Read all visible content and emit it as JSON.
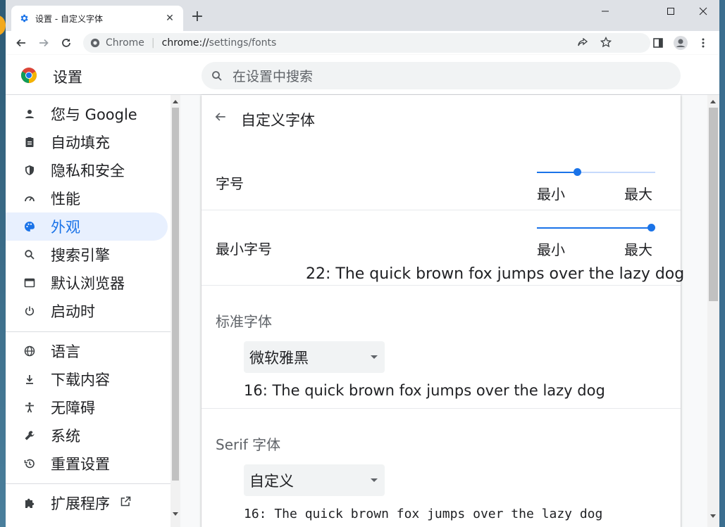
{
  "tab": {
    "title": "设置 - 自定义字体",
    "close": "✕",
    "new_tab": "+"
  },
  "window_controls": {
    "minimize": "—",
    "maximize": "☐",
    "close": "✕"
  },
  "omnibox": {
    "site": "Chrome",
    "url_host": "chrome://",
    "url_rest": "settings/fonts"
  },
  "header": {
    "title": "设置",
    "search_placeholder": "在设置中搜索"
  },
  "sidebar": {
    "items": [
      {
        "label": "您与 Google",
        "icon": "person-icon"
      },
      {
        "label": "自动填充",
        "icon": "clipboard-icon"
      },
      {
        "label": "隐私和安全",
        "icon": "shield-icon"
      },
      {
        "label": "性能",
        "icon": "speedometer-icon"
      },
      {
        "label": "外观",
        "icon": "palette-icon",
        "active": true
      },
      {
        "label": "搜索引擎",
        "icon": "search-icon"
      },
      {
        "label": "默认浏览器",
        "icon": "browser-icon"
      },
      {
        "label": "启动时",
        "icon": "power-icon"
      },
      {
        "label": "语言",
        "icon": "globe-icon"
      },
      {
        "label": "下载内容",
        "icon": "download-icon"
      },
      {
        "label": "无障碍",
        "icon": "accessibility-icon"
      },
      {
        "label": "系统",
        "icon": "wrench-icon"
      },
      {
        "label": "重置设置",
        "icon": "restore-icon"
      },
      {
        "label": "扩展程序",
        "icon": "puzzle-icon"
      }
    ]
  },
  "page": {
    "title": "自定义字体",
    "font_size": {
      "label": "字号",
      "min_label": "最小",
      "max_label": "最大",
      "level": 0.33
    },
    "min_font_size": {
      "label": "最小字号",
      "min_label": "最小",
      "max_label": "最大",
      "level": 1.0,
      "sample": "22: The quick brown fox jumps over the lazy dog"
    },
    "standard_font": {
      "label": "标准字体",
      "value": "微软雅黑",
      "sample": "16: The quick brown fox jumps over the lazy dog"
    },
    "serif_font": {
      "label": "Serif 字体",
      "value": "自定义",
      "sample": "16: The quick brown fox jumps over the lazy dog"
    }
  },
  "colors": {
    "accent": "#1a73e8",
    "active_bg": "#e8f0fe"
  }
}
